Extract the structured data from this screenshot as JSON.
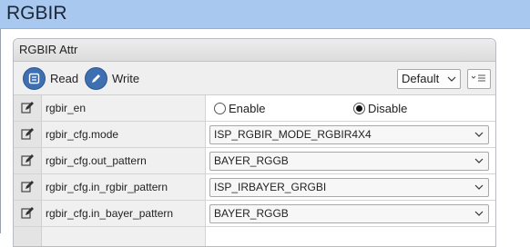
{
  "window": {
    "title": "RGBIR"
  },
  "panel": {
    "title": "RGBIR Attr"
  },
  "toolbar": {
    "read_label": "Read",
    "write_label": "Write",
    "preset_value": "Default"
  },
  "rows": [
    {
      "name": "rgbir_en",
      "type": "radio",
      "options": [
        "Enable",
        "Disable"
      ],
      "selected": "Disable"
    },
    {
      "name": "rgbir_cfg.mode",
      "type": "select",
      "value": "ISP_RGBIR_MODE_RGBIR4X4"
    },
    {
      "name": "rgbir_cfg.out_pattern",
      "type": "select",
      "value": "BAYER_RGGB"
    },
    {
      "name": "rgbir_cfg.in_rgbir_pattern",
      "type": "select",
      "value": "ISP_IRBAYER_GRGBI"
    },
    {
      "name": "rgbir_cfg.in_bayer_pattern",
      "type": "select",
      "value": "BAYER_RGGB"
    }
  ],
  "colors": {
    "title_bar": "#a9c8ef",
    "button_blue": "#3e6fb0"
  }
}
